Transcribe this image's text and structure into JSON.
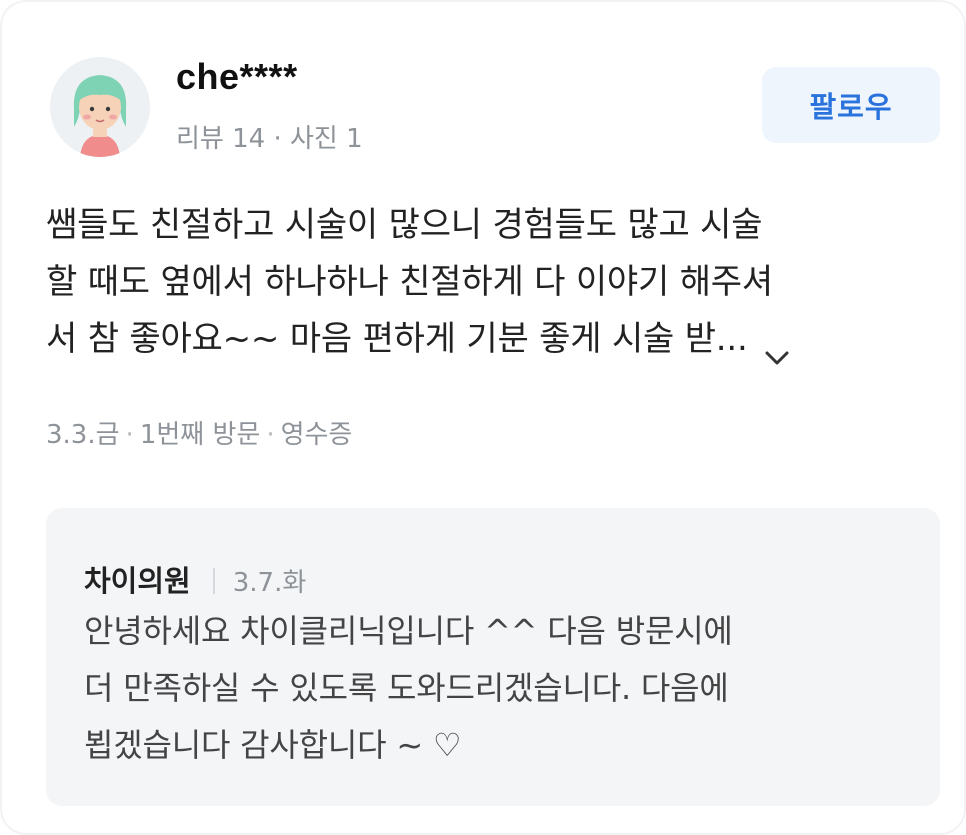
{
  "reviewer": {
    "username": "che****",
    "stats": "리뷰 14 · 사진 1",
    "follow_label": "팔로우"
  },
  "review": {
    "lines": [
      "쌤들도 친절하고 시술이 많으니 경험들도 많고 시술",
      "할 때도 옆에서 하나하나 친절하게 다 이야기 해주셔",
      "서 참 좋아요~~ 마음 편하게 기분 좋게 시술 받..."
    ],
    "expand_icon": "chevron-down-icon",
    "visit_date": "3.3.금",
    "visit_count": "1번째 방문",
    "verification": "영수증"
  },
  "reply": {
    "author": "차이의원",
    "date": "3.7.화",
    "lines": [
      "안녕하세요 차이클리닉입니다 ^^ 다음 방문시에",
      "더 만족하실 수 있도록 도와드리겠습니다. 다음에",
      "뵙겠습니다 감사합니다 ~ ♡"
    ]
  },
  "colors": {
    "follow_text": "#2a73dd",
    "follow_bg": "#eef5fd",
    "reply_bg": "#f3f5f7",
    "meta_text": "#8e9399"
  }
}
